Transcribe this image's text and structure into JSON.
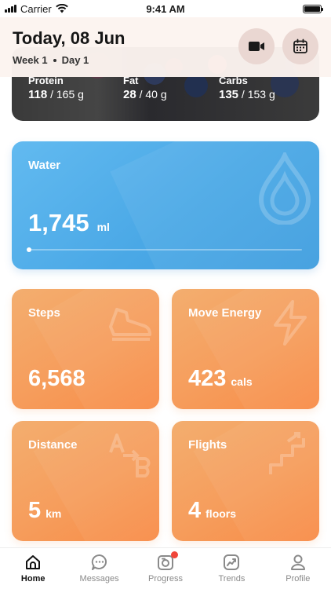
{
  "status_bar": {
    "carrier": "Carrier",
    "time": "9:41 AM",
    "battery_percent": 100
  },
  "header": {
    "title": "Today, 08 Jun",
    "week": "Week 1",
    "day": "Day 1",
    "video_icon": "video-camera-icon",
    "calendar_icon": "calendar-icon"
  },
  "nutrition": {
    "protein": {
      "label": "Protein",
      "value": "118",
      "goal": "/ 165 g"
    },
    "fat": {
      "label": "Fat",
      "value": "28",
      "goal": "/ 40 g"
    },
    "carbs": {
      "label": "Carbs",
      "value": "135",
      "goal": "/ 153 g"
    }
  },
  "water": {
    "title": "Water",
    "value": "1,745",
    "unit": "ml",
    "progress_fraction": 0.0,
    "icon": "water-drop-icon"
  },
  "steps": {
    "title": "Steps",
    "value": "6,568",
    "unit": "",
    "icon": "shoe-icon"
  },
  "move_energy": {
    "title": "Move Energy",
    "value": "423",
    "unit": "cals",
    "icon": "lightning-icon"
  },
  "distance": {
    "title": "Distance",
    "value": "5",
    "unit": "km",
    "icon": "a-to-b-icon"
  },
  "flights": {
    "title": "Flights",
    "value": "4",
    "unit": "floors",
    "icon": "stairs-icon"
  },
  "tabs": [
    {
      "label": "Home",
      "icon": "home-icon",
      "active": true
    },
    {
      "label": "Messages",
      "icon": "chat-bubble-icon",
      "active": false
    },
    {
      "label": "Progress",
      "icon": "camera-icon",
      "active": false,
      "badge": true
    },
    {
      "label": "Trends",
      "icon": "trend-chart-icon",
      "active": false
    },
    {
      "label": "Profile",
      "icon": "person-icon",
      "active": false
    }
  ],
  "colors": {
    "water": "#4aa8e6",
    "activity": "#f69d5c",
    "badge": "#f0463a"
  }
}
